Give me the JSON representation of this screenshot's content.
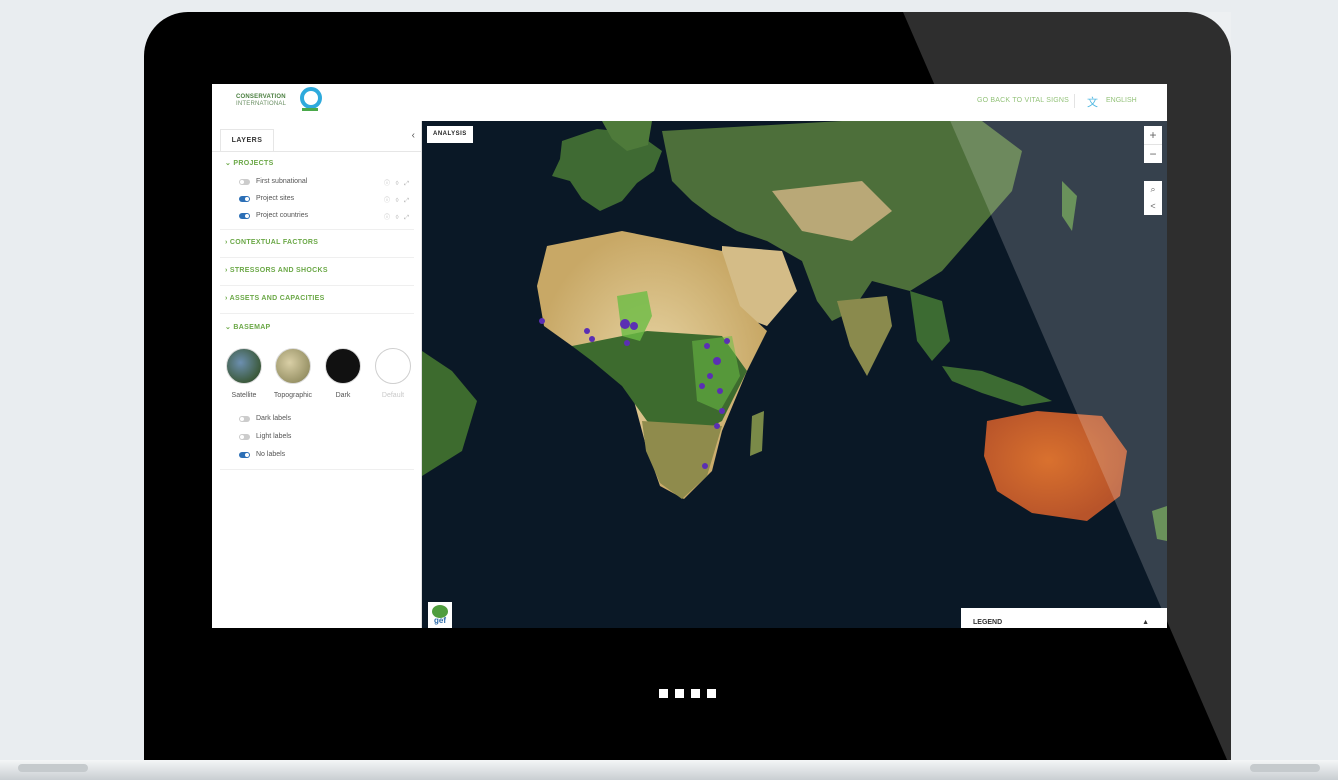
{
  "header": {
    "logo_line1": "CONSERVATION",
    "logo_line2": "INTERNATIONAL",
    "back_link": "GO BACK TO VITAL SIGNS",
    "language": "ENGLISH"
  },
  "sidebar": {
    "tab_label": "LAYERS",
    "collapse_icon": "‹",
    "projects": {
      "title": "PROJECTS",
      "layers": [
        {
          "label": "First subnational",
          "on": false
        },
        {
          "label": "Project sites",
          "on": true
        },
        {
          "label": "Project countries",
          "on": true
        }
      ]
    },
    "groups": [
      {
        "title": "CONTEXTUAL FACTORS"
      },
      {
        "title": "STRESSORS AND SHOCKS"
      },
      {
        "title": "ASSETS AND CAPACITIES"
      }
    ],
    "basemap": {
      "title": "BASEMAP",
      "options": [
        {
          "label": "Satellite",
          "color": "#4a6a4a"
        },
        {
          "label": "Topographic",
          "color": "#b9a67a"
        },
        {
          "label": "Dark",
          "color": "#111111"
        },
        {
          "label": "Default",
          "color": "#ffffff"
        }
      ],
      "labels_options": [
        {
          "label": "Dark labels",
          "on": false
        },
        {
          "label": "Light labels",
          "on": false
        },
        {
          "label": "No labels",
          "on": true
        }
      ]
    }
  },
  "map": {
    "analysis_button": "ANALYSIS",
    "zoom_in": "+",
    "zoom_out": "−",
    "search_icon": "⌕",
    "share_icon": "<",
    "gef_label": "gef",
    "legend_label": "LEGEND",
    "legend_toggle": "▲"
  },
  "colors": {
    "accent_green": "#6ba847",
    "toggle_on": "#2c6fb6",
    "logo_blue": "#2eaadc"
  }
}
